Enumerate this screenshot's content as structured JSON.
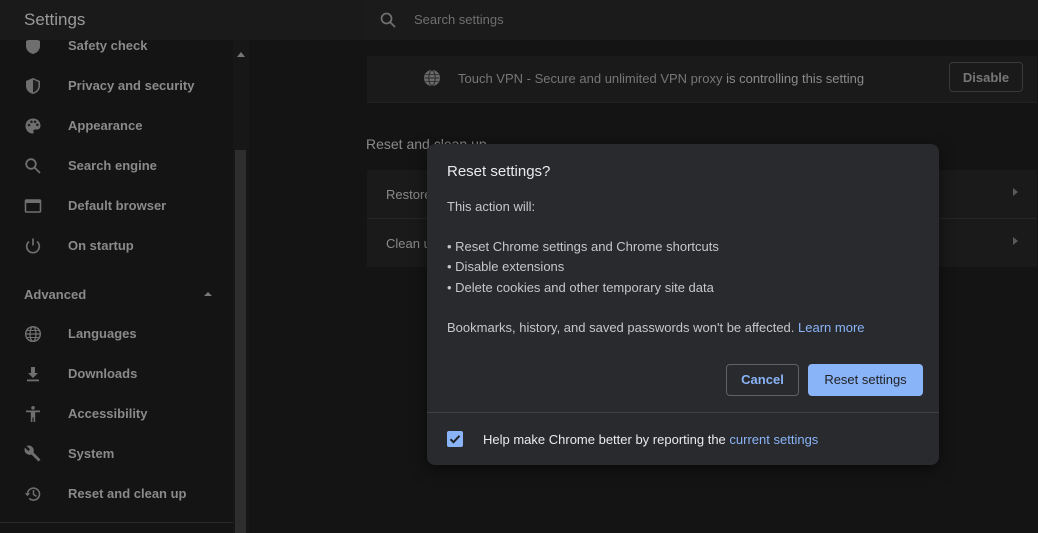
{
  "app": {
    "title": "Settings"
  },
  "search": {
    "placeholder": "Search settings"
  },
  "sidebar": {
    "items": [
      {
        "label": "Safety check",
        "icon": "shield-check-icon"
      },
      {
        "label": "Privacy and security",
        "icon": "shield-icon"
      },
      {
        "label": "Appearance",
        "icon": "palette-icon"
      },
      {
        "label": "Search engine",
        "icon": "search-icon"
      },
      {
        "label": "Default browser",
        "icon": "browser-icon"
      },
      {
        "label": "On startup",
        "icon": "power-icon"
      }
    ],
    "advanced_label": "Advanced",
    "advanced_items": [
      {
        "label": "Languages",
        "icon": "globe-icon"
      },
      {
        "label": "Downloads",
        "icon": "download-icon"
      },
      {
        "label": "Accessibility",
        "icon": "accessibility-icon"
      },
      {
        "label": "System",
        "icon": "wrench-icon"
      },
      {
        "label": "Reset and clean up",
        "icon": "history-icon"
      }
    ]
  },
  "banner": {
    "extension_name": "Touch VPN - Secure and unlimited VPN proxy",
    "controlling_text": "is controlling this setting",
    "disable_label": "Disable"
  },
  "section": {
    "title": "Reset and clean up",
    "rows": [
      {
        "label": "Restore"
      },
      {
        "label": "Clean u"
      }
    ]
  },
  "dialog": {
    "title": "Reset settings?",
    "intro": "This action will:",
    "bullets": [
      "• Reset Chrome settings and Chrome shortcuts",
      "• Disable extensions",
      "• Delete cookies and other temporary site data"
    ],
    "note": "Bookmarks, history, and saved passwords won't be affected.",
    "learn_more": "Learn more",
    "cancel_label": "Cancel",
    "reset_label": "Reset settings",
    "report_text": "Help make Chrome better by reporting the",
    "report_link": "current settings",
    "report_checked": true
  },
  "colors": {
    "accent": "#8ab4f8",
    "dialog_bg": "#292a2d",
    "page_bg": "#141414"
  }
}
